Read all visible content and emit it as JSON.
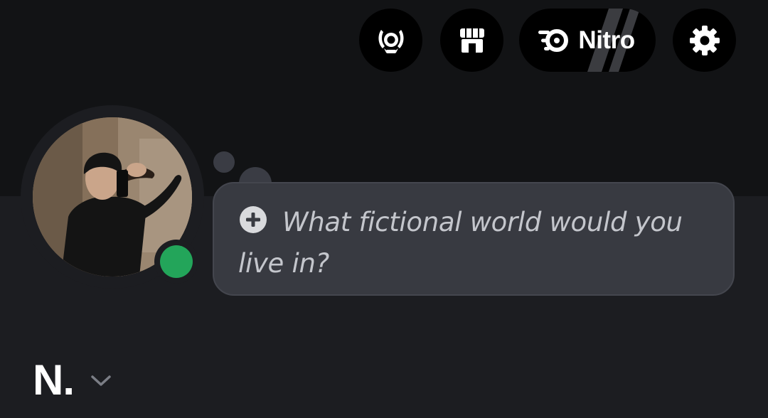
{
  "header": {
    "buttons": {
      "quests": {
        "icon": "quests-laurel-icon"
      },
      "shop": {
        "icon": "shop-storefront-icon"
      },
      "nitro": {
        "icon": "nitro-icon",
        "label": "Nitro"
      },
      "settings": {
        "icon": "gear-icon"
      }
    }
  },
  "profile": {
    "avatar": {
      "icon": "profile-photo",
      "status": "online",
      "status_color": "#23a55a"
    },
    "custom_status": {
      "icon": "plus-circle-icon",
      "placeholder": "What fictional world would you live in?"
    },
    "display_name": "N.",
    "name_menu_icon": "chevron-down-icon"
  },
  "colors": {
    "banner": "#121315",
    "background": "#1c1d21",
    "bubble": "#383a41",
    "status_online": "#23a55a"
  }
}
